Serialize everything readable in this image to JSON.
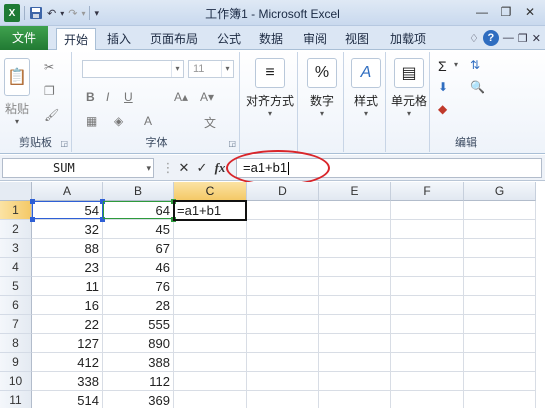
{
  "window": {
    "title": "工作簿1 - Microsoft Excel",
    "app_icon": "X",
    "qat": {
      "save_icon": "save-icon",
      "undo_icon": "undo-icon",
      "redo_icon": "redo-icon"
    }
  },
  "tabs": {
    "file": "文件",
    "items": [
      "开始",
      "插入",
      "页面布局",
      "公式",
      "数据",
      "审阅",
      "视图",
      "加载项"
    ],
    "active": "开始"
  },
  "ribbon": {
    "clipboard": {
      "label": "剪贴板",
      "paste": "粘贴"
    },
    "font": {
      "label": "字体",
      "size": "11",
      "bold": "B",
      "italic": "I",
      "underline": "U"
    },
    "alignment": {
      "label": "对齐方式"
    },
    "number": {
      "label": "数字",
      "symbol": "%"
    },
    "styles": {
      "label": "样式"
    },
    "cells": {
      "label": "单元格"
    },
    "editing": {
      "label": "编辑",
      "sigma": "Σ"
    }
  },
  "formula_bar": {
    "name_box": "SUM",
    "formula": "=a1+b1",
    "fx": "fx",
    "cancel": "✕",
    "enter": "✓"
  },
  "grid": {
    "columns": [
      "A",
      "B",
      "C",
      "D",
      "E",
      "F",
      "G"
    ],
    "selected_column": "C",
    "selected_row": 1,
    "rows": [
      {
        "n": "1",
        "a": "54",
        "b": "64",
        "c": "=a1+b1"
      },
      {
        "n": "2",
        "a": "32",
        "b": "45",
        "c": ""
      },
      {
        "n": "3",
        "a": "88",
        "b": "67",
        "c": ""
      },
      {
        "n": "4",
        "a": "23",
        "b": "46",
        "c": ""
      },
      {
        "n": "5",
        "a": "11",
        "b": "76",
        "c": ""
      },
      {
        "n": "6",
        "a": "16",
        "b": "28",
        "c": ""
      },
      {
        "n": "7",
        "a": "22",
        "b": "555",
        "c": ""
      },
      {
        "n": "8",
        "a": "127",
        "b": "890",
        "c": ""
      },
      {
        "n": "9",
        "a": "412",
        "b": "388",
        "c": ""
      },
      {
        "n": "10",
        "a": "338",
        "b": "112",
        "c": ""
      },
      {
        "n": "11",
        "a": "514",
        "b": "369",
        "c": ""
      }
    ]
  },
  "colors": {
    "file_tab": "#217a33",
    "ref_a": "#2e5fd6",
    "ref_b": "#2e9a3c",
    "annotation": "#d9252a",
    "selected_header": "#f4c967"
  }
}
